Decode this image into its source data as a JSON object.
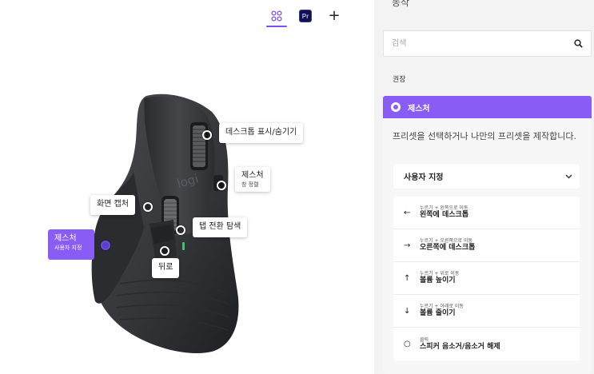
{
  "toolbar": {
    "app_tabs": [
      {
        "name": "all-apps",
        "icon": "grid-icon"
      },
      {
        "name": "premiere-pro",
        "badge": "Pr"
      },
      {
        "name": "add-app",
        "label": "+"
      }
    ]
  },
  "callouts": {
    "desktop_toggle": "데스크톱 표시/숨기기",
    "gesture_top": "제스처",
    "gesture_top_sub": "창 정렬",
    "screen_capture": "화면 캡처",
    "tab_switch": "탭 전환 탐색",
    "back": "뒤로",
    "gesture_custom": "제스처",
    "gesture_custom_sub": "사용자 지정"
  },
  "panel": {
    "title": "동작",
    "search_placeholder": "검색",
    "section_label": "권장",
    "active_item": "제스처",
    "description": "프리셋을 선택하거나 나만의 프리셋을 제작합니다.",
    "preset_select": "사용자 지정",
    "actions": [
      {
        "icon": "←",
        "hint": "누르기 + 왼쪽으로 이동",
        "label": "왼쪽에 데스크톱"
      },
      {
        "icon": "→",
        "hint": "누르기 + 오른쪽으로 이동",
        "label": "오른쪽에 데스크톱"
      },
      {
        "icon": "↑",
        "hint": "누르기 + 위로 이동",
        "label": "볼륨 높이기"
      },
      {
        "icon": "↓",
        "hint": "누르기 + 아래로 이동",
        "label": "볼륨 줄이기"
      },
      {
        "icon": "○",
        "hint": "클릭",
        "label": "스피커 음소거/음소거 해제"
      }
    ]
  },
  "colors": {
    "accent": "#8a5cf6",
    "panel_bg": "#f3f3f4",
    "mouse_body": "#3a3b3f"
  }
}
